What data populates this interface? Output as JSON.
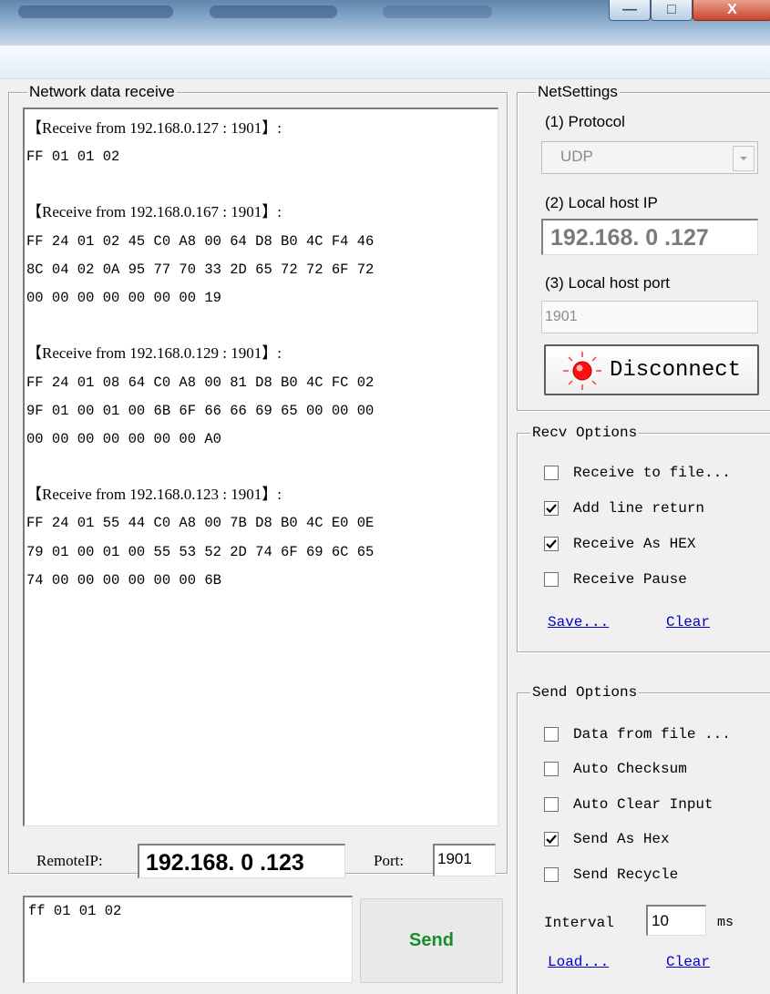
{
  "window": {
    "controls": {
      "minimize": "—",
      "maximize": "□",
      "close": "X"
    }
  },
  "receive": {
    "group_label": "Network data receive",
    "blocks": [
      {
        "header": "【Receive from 192.168.0.127 : 1901】:",
        "lines": [
          "FF 01 01 02"
        ]
      },
      {
        "header": "【Receive from 192.168.0.167 : 1901】:",
        "lines": [
          "FF 24 01 02 45 C0 A8 00 64 D8 B0 4C F4 46",
          "8C 04 02 0A 95 77 70 33 2D 65 72 72 6F 72",
          "00 00 00 00 00 00 00 19"
        ]
      },
      {
        "header": "【Receive from 192.168.0.129 : 1901】:",
        "lines": [
          "FF 24 01 08 64 C0 A8 00 81 D8 B0 4C FC 02",
          "9F 01 00 01 00 6B 6F 66 66 69 65 00 00 00",
          "00 00 00 00 00 00 00 A0"
        ]
      },
      {
        "header": "【Receive from 192.168.0.123 : 1901】:",
        "lines": [
          "FF 24 01 55 44 C0 A8 00 7B D8 B0 4C E0 0E",
          "79 01 00 01 00 55 53 52 2D 74 6F 69 6C 65",
          "74 00 00 00 00 00 00 6B"
        ]
      }
    ]
  },
  "remote": {
    "ip_label": "RemoteIP:",
    "ip_value": "192.168. 0 .123",
    "port_label": "Port:",
    "port_value": "1901"
  },
  "send": {
    "input_value": "ff 01 01 02",
    "button_label": "Send"
  },
  "net_settings": {
    "group_label": "NetSettings",
    "protocol_label": "(1) Protocol",
    "protocol_value": "UDP",
    "local_ip_label": "(2) Local host IP",
    "local_ip_value": "192.168. 0 .127",
    "local_port_label": "(3) Local host port",
    "local_port_value": "1901",
    "disconnect_label": "Disconnect"
  },
  "recv_options": {
    "group_label": "Recv Options",
    "items": [
      {
        "label": "Receive to file...",
        "checked": false
      },
      {
        "label": "Add line return",
        "checked": true
      },
      {
        "label": "Receive As HEX",
        "checked": true
      },
      {
        "label": "Receive Pause",
        "checked": false
      }
    ],
    "save_link": "Save...",
    "clear_link": "Clear"
  },
  "send_options": {
    "group_label": "Send Options",
    "items": [
      {
        "label": "Data from file ...",
        "checked": false
      },
      {
        "label": "Auto Checksum",
        "checked": false
      },
      {
        "label": "Auto Clear Input",
        "checked": false
      },
      {
        "label": "Send As Hex",
        "checked": true
      },
      {
        "label": "Send Recycle",
        "checked": false
      }
    ],
    "interval_label": "Interval",
    "interval_value": "10",
    "interval_unit": "ms",
    "load_link": "Load...",
    "clear_link": "Clear"
  }
}
